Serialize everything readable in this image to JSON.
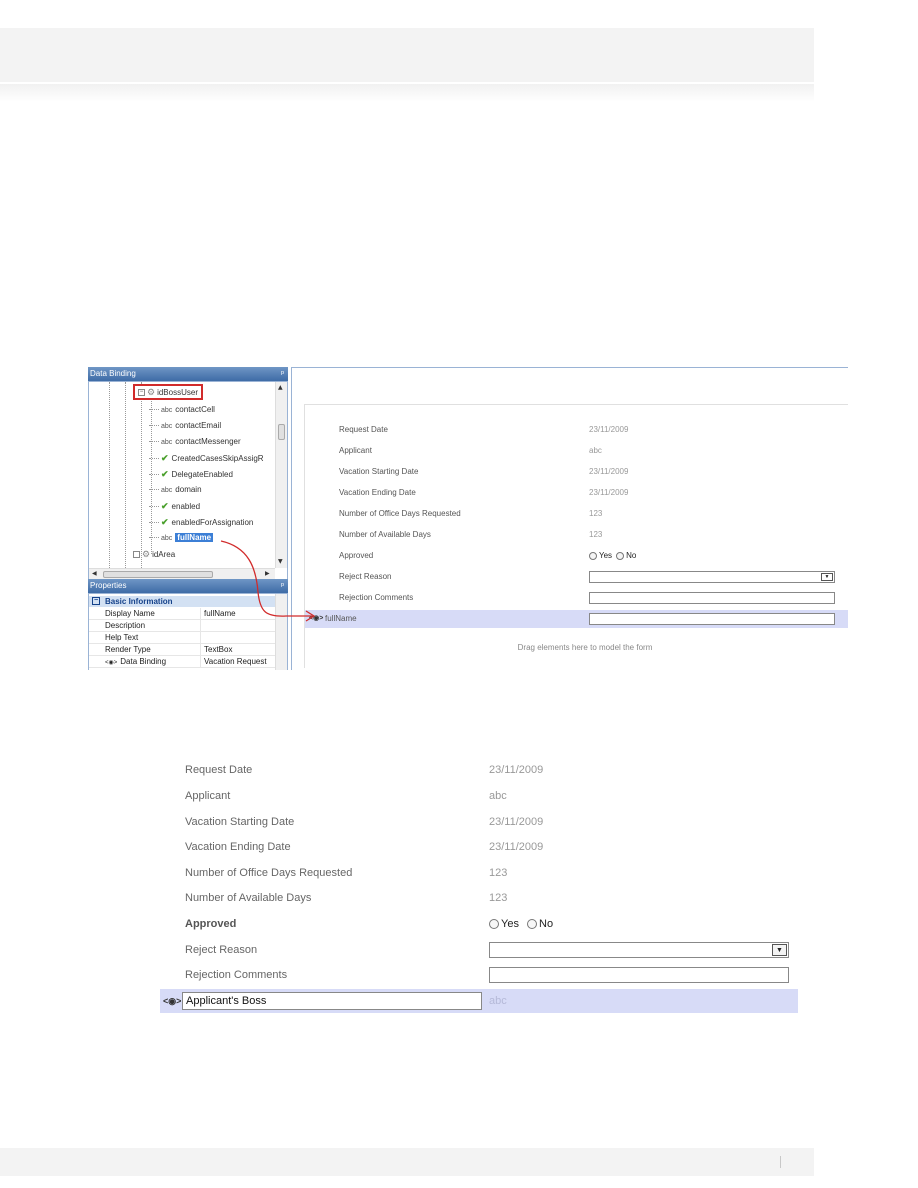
{
  "designer": {
    "data_binding_title": "Data Binding",
    "properties_title": "Properties",
    "pin_glyph": "ᵖ",
    "tree": {
      "root": "idBossUser",
      "items": [
        {
          "kind": "abc",
          "label": "contactCell"
        },
        {
          "kind": "abc",
          "label": "contactEmail"
        },
        {
          "kind": "abc",
          "label": "contactMessenger"
        },
        {
          "kind": "check",
          "label": "CreatedCasesSkipAssigR"
        },
        {
          "kind": "check",
          "label": "DelegateEnabled"
        },
        {
          "kind": "abc",
          "label": "domain"
        },
        {
          "kind": "check",
          "label": "enabled"
        },
        {
          "kind": "check",
          "label": "enabledForAssignation"
        },
        {
          "kind": "abc",
          "label": "fullName"
        }
      ],
      "next_item": "idArea",
      "abc_glyph": "abc",
      "check_glyph": "✔"
    },
    "properties": {
      "group": "Basic Information",
      "rows": [
        {
          "key": "Display Name",
          "value": "fullName"
        },
        {
          "key": "Description",
          "value": ""
        },
        {
          "key": "Help Text",
          "value": ""
        },
        {
          "key": "Render Type",
          "value": "TextBox"
        },
        {
          "key": "Data Binding",
          "value": "Vacation Request"
        }
      ]
    },
    "form_rows": [
      {
        "label": "Request Date",
        "value": "23/11/2009"
      },
      {
        "label": "Applicant",
        "value": "abc"
      },
      {
        "label": "Vacation Starting Date",
        "value": "23/11/2009"
      },
      {
        "label": "Vacation Ending Date",
        "value": "23/11/2009"
      },
      {
        "label": "Number of Office Days Requested",
        "value": "123"
      },
      {
        "label": "Number of Available Days",
        "value": "123"
      }
    ],
    "approved_label": "Approved",
    "reject_reason_label": "Reject Reason",
    "rejection_comments_label": "Rejection Comments",
    "new_field_label": "fullName",
    "drag_hint": "Drag elements here to model the form"
  },
  "form": {
    "rows": [
      {
        "label": "Request Date",
        "value": "23/11/2009"
      },
      {
        "label": "Applicant",
        "value": "abc"
      },
      {
        "label": "Vacation Starting Date",
        "value": "23/11/2009"
      },
      {
        "label": "Vacation Ending Date",
        "value": "23/11/2009"
      },
      {
        "label": "Number of Office Days Requested",
        "value": "123"
      },
      {
        "label": "Number of Available Days",
        "value": "123"
      }
    ],
    "approved_label": "Approved",
    "yes_label": "Yes",
    "no_label": "No",
    "reject_reason_label": "Reject Reason",
    "rejection_comments_label": "Rejection Comments",
    "boss_label": "Applicant's Boss",
    "boss_value": "abc"
  },
  "icons": {
    "binding": "<◉>",
    "dropdown": "▼",
    "expander_minus": "−",
    "gear": "⚙",
    "scroll_up": "▲",
    "scroll_down": "▼",
    "scroll_left": "◀",
    "scroll_right": "▶"
  },
  "colors": {
    "highlight_row": "#d7dbf7",
    "selected_node": "#3c7fd6",
    "callout_red": "#d12b2b",
    "pane_title": "#3e6ba6"
  }
}
